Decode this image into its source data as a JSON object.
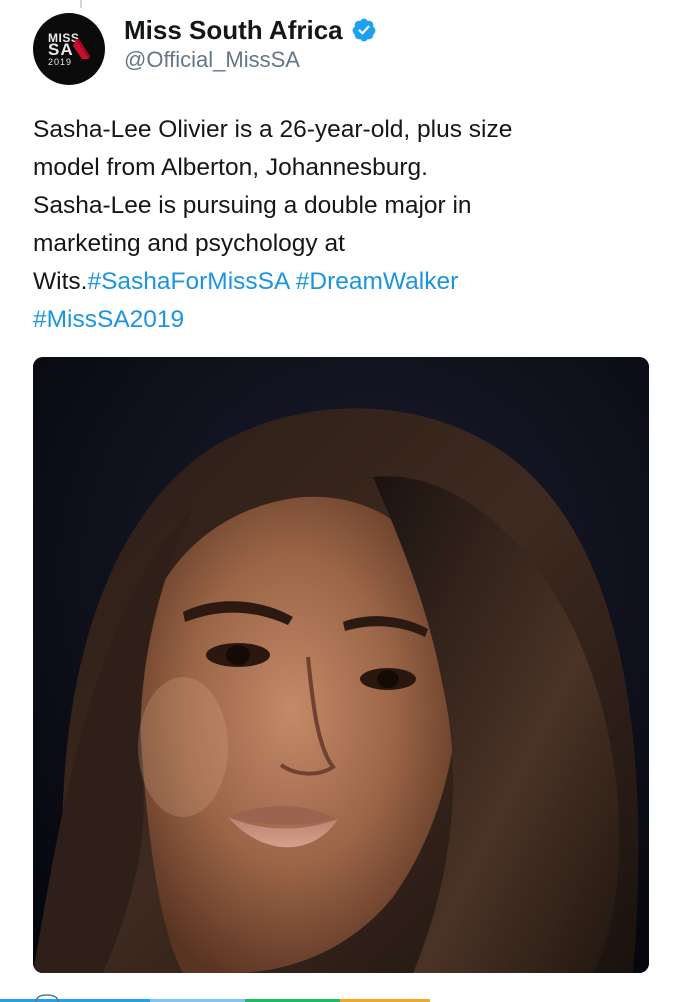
{
  "account": {
    "display_name": "Miss South Africa",
    "handle": "@Official_MissSA",
    "verified": true,
    "avatar": {
      "text_top": "MISS",
      "text_mid": "SA",
      "text_year": "2019",
      "accent": "#c8102e"
    }
  },
  "tweet": {
    "text_lines": [
      "Sasha-Lee Olivier is a 26-year-old, plus size",
      "model from Alberton, Johannesburg.",
      "Sasha-Lee is pursuing a double major in",
      "marketing and psychology at"
    ],
    "last_line_prefix": "Wits.",
    "hashtags": [
      "#SashaForMissSA",
      "#DreamWalker",
      "#MissSA2019"
    ]
  },
  "media": {
    "description_icon": "portrait-photo",
    "alt_shown": ""
  },
  "colors": {
    "link": "#1b95e0",
    "text": "#14171a",
    "secondary": "#657786",
    "verified": "#1da1f2"
  }
}
